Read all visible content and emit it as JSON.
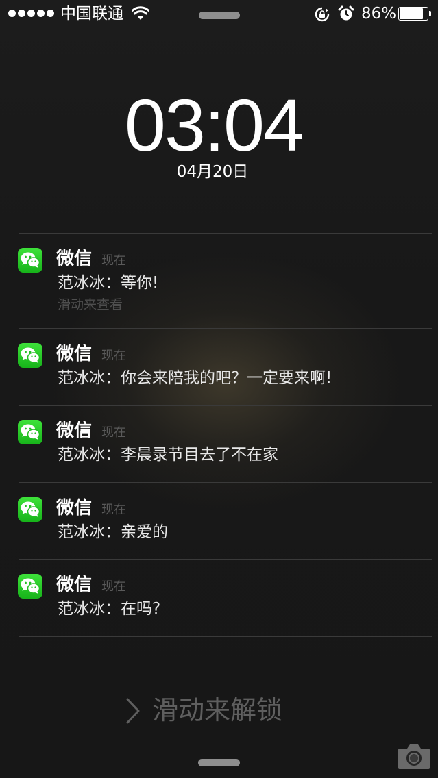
{
  "status_bar": {
    "carrier": "中国联通",
    "battery_percent": "86%",
    "battery_level": 0.86,
    "signal_bars": 5
  },
  "clock": {
    "time": "03:04",
    "date": "04月20日"
  },
  "notifications": [
    {
      "app": "微信",
      "time": "现在",
      "message": "范冰冰：等你!",
      "action": "滑动来查看"
    },
    {
      "app": "微信",
      "time": "现在",
      "message": "范冰冰：你会来陪我的吧？一定要来啊!"
    },
    {
      "app": "微信",
      "time": "现在",
      "message": "范冰冰：李晨录节目去了不在家"
    },
    {
      "app": "微信",
      "time": "现在",
      "message": "范冰冰：亲爱的"
    },
    {
      "app": "微信",
      "time": "现在",
      "message": "范冰冰：在吗?"
    }
  ],
  "unlock": {
    "label": "滑动来解锁"
  },
  "icons": {
    "app_icon": "wechat-icon",
    "wifi": "wifi-icon",
    "rotation_lock": "rotation-lock-icon",
    "alarm": "alarm-icon",
    "battery": "battery-icon",
    "camera": "camera-icon",
    "chevron": "chevron-right-icon"
  },
  "colors": {
    "wechat_green": "#2dcc2d"
  }
}
